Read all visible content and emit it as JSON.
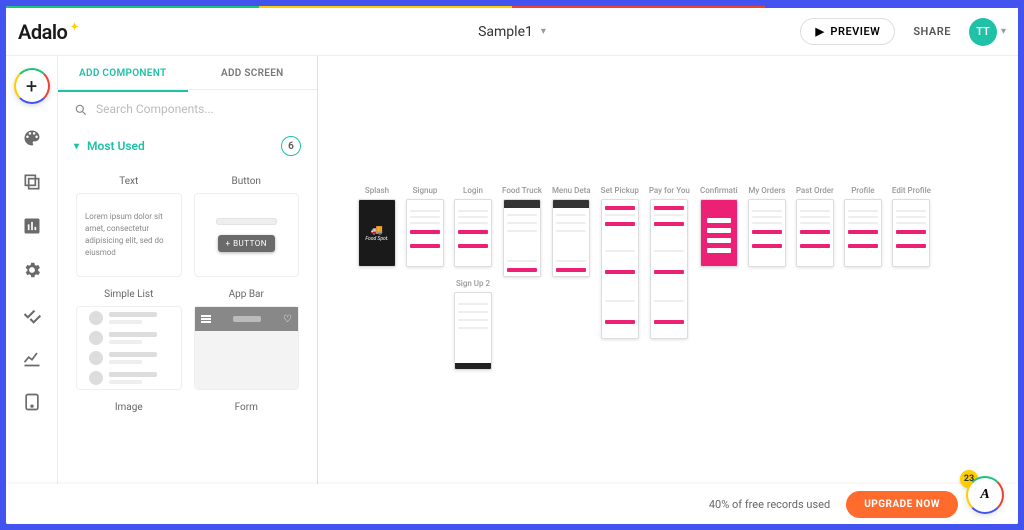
{
  "brand": {
    "name": "Adalo"
  },
  "topbar": {
    "project_name": "Sample1",
    "preview_label": "PREVIEW",
    "share_label": "SHARE",
    "avatar_initials": "TT"
  },
  "panel": {
    "tabs": {
      "add_component": "ADD COMPONENT",
      "add_screen": "ADD SCREEN"
    },
    "search_placeholder": "Search Components...",
    "section": {
      "title": "Most Used",
      "count": "6"
    },
    "components": {
      "text": {
        "title": "Text",
        "lipsum": "Lorem ipsum dolor sit amet, consectetur adipisicing elit, sed do eiusmod"
      },
      "button": {
        "title": "Button",
        "btn_label": "+ BUTTON"
      },
      "simple_list": {
        "title": "Simple List"
      },
      "app_bar": {
        "title": "App Bar"
      },
      "image": {
        "title": "Image"
      },
      "form": {
        "title": "Form"
      }
    }
  },
  "canvas": {
    "screens": [
      {
        "label": "Splash",
        "variant": "dark",
        "logo_text": "Food Spot."
      },
      {
        "label": "Signup",
        "variant": "form"
      },
      {
        "label": "Login",
        "variant": "form",
        "sub_label": "Sign Up 2"
      },
      {
        "label": "Food Truck",
        "variant": "menu"
      },
      {
        "label": "Menu Deta",
        "variant": "detail"
      },
      {
        "label": "Set Pickup",
        "variant": "tall"
      },
      {
        "label": "Pay for You",
        "variant": "pay"
      },
      {
        "label": "Confirmati",
        "variant": "pink"
      },
      {
        "label": "My Orders",
        "variant": "list"
      },
      {
        "label": "Past Order",
        "variant": "list"
      },
      {
        "label": "Profile",
        "variant": "profile"
      },
      {
        "label": "Edit Profile",
        "variant": "form"
      }
    ]
  },
  "footer": {
    "usage_text": "40% of free records used",
    "upgrade_label": "UPGRADE NOW",
    "notif_count": "23"
  }
}
